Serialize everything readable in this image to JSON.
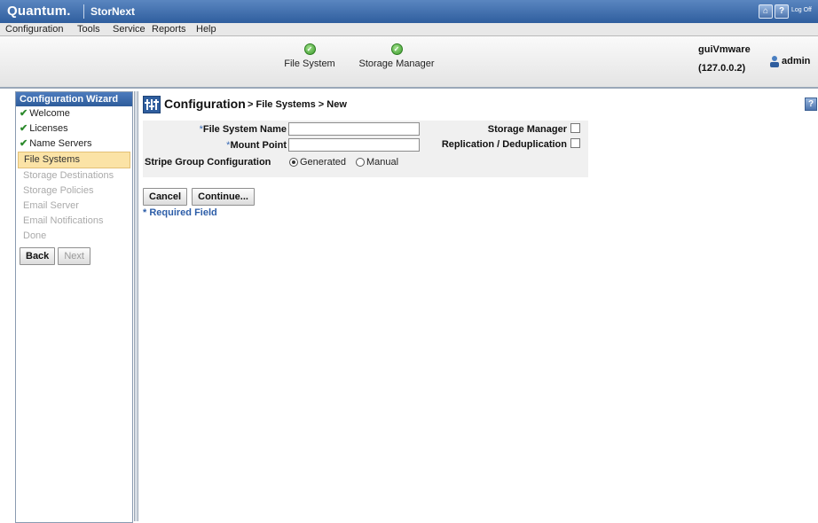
{
  "brand": {
    "logo": "Quantum.",
    "product": "StorNext",
    "logoff": "Log Off"
  },
  "menu": [
    "Configuration",
    "Tools",
    "Service",
    "Reports",
    "Help"
  ],
  "status": {
    "items": [
      {
        "label": "File System",
        "state": "ok"
      },
      {
        "label": "Storage Manager",
        "state": "ok"
      }
    ],
    "server_name": "guiVmware",
    "server_ip": "(127.0.0.2)",
    "user": "admin"
  },
  "wizard": {
    "title": "Configuration Wizard",
    "steps": [
      {
        "label": "Welcome",
        "state": "done"
      },
      {
        "label": "Licenses",
        "state": "done"
      },
      {
        "label": "Name Servers",
        "state": "done"
      },
      {
        "label": "File Systems",
        "state": "current"
      },
      {
        "label": "Storage Destinations",
        "state": "todo"
      },
      {
        "label": "Storage Policies",
        "state": "todo"
      },
      {
        "label": "Email Server",
        "state": "todo"
      },
      {
        "label": "Email Notifications",
        "state": "todo"
      },
      {
        "label": "Done",
        "state": "todo"
      }
    ],
    "back_label": "Back",
    "next_label": "Next"
  },
  "page": {
    "title": "Configuration",
    "crumb": "> File Systems > New",
    "help": "?"
  },
  "form": {
    "required_mark": "*",
    "fs_name_label": "File System Name",
    "fs_name_value": "",
    "mount_point_label": "Mount Point",
    "mount_point_value": "",
    "storage_manager_label": "Storage Manager",
    "storage_manager_checked": false,
    "replication_label": "Replication / Deduplication",
    "replication_checked": false,
    "stripe_label": "Stripe Group Configuration",
    "stripe_options": [
      "Generated",
      "Manual"
    ],
    "stripe_selected": "Generated"
  },
  "actions": {
    "cancel_label": "Cancel",
    "continue_label": "Continue..."
  },
  "required_note": "* Required Field",
  "colors": {
    "brand_blue": "#2f5e9e",
    "selected_step": "#fbe3a6",
    "ok_green": "#3b9a2b",
    "link_blue": "#2c5da8"
  }
}
